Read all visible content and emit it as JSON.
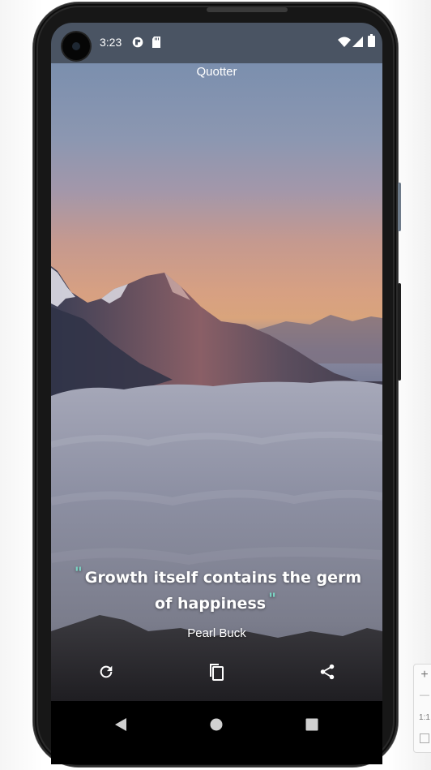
{
  "status_bar": {
    "time": "3:23",
    "icons": [
      "camera-cutout",
      "app-notification-icon",
      "sd-card-icon",
      "wifi-icon",
      "signal-icon",
      "battery-icon"
    ]
  },
  "app": {
    "title": "Quotter"
  },
  "quote": {
    "open_mark": "\"",
    "text": "Growth itself contains the germ of happiness",
    "close_mark": "\"",
    "author": "Pearl Buck"
  },
  "actions": [
    "refresh-icon",
    "copy-icon",
    "share-icon"
  ],
  "nav": [
    "back-icon",
    "home-icon",
    "recents-icon"
  ],
  "zoom_panel": {
    "plus": "+",
    "minus": "—",
    "ratio": "1:1"
  },
  "colors": {
    "quote_mark": "#7bd3c3",
    "status_bar": "#4a5463"
  }
}
